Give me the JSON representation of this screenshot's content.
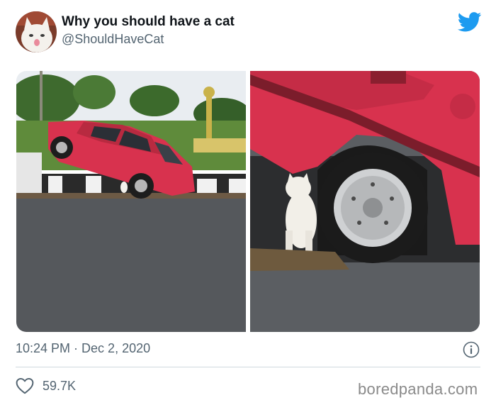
{
  "tweet": {
    "display_name": "Why you should have a cat",
    "handle": "@ShouldHaveCat",
    "timestamp": "10:24 PM · Dec 2, 2020",
    "likes": "59.7K",
    "avatar_icon": "cat-avatar",
    "platform_icon": "twitter-bird-icon",
    "platform_color": "#1d9bf0"
  },
  "media": [
    {
      "name": "photo-car-on-curb"
    },
    {
      "name": "photo-cat-under-car"
    }
  ],
  "footer": {
    "watermark": "boredpanda.com"
  },
  "colors": {
    "text_primary": "#0f1419",
    "text_secondary": "#536471",
    "divider": "#cfd9de",
    "car_red": "#d8324e"
  }
}
